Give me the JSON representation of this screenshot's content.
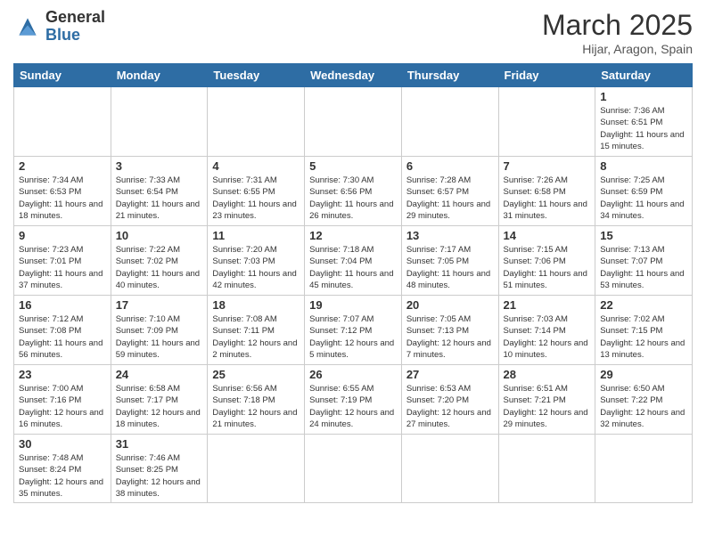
{
  "header": {
    "logo_general": "General",
    "logo_blue": "Blue",
    "month_title": "March 2025",
    "location": "Hijar, Aragon, Spain"
  },
  "weekdays": [
    "Sunday",
    "Monday",
    "Tuesday",
    "Wednesday",
    "Thursday",
    "Friday",
    "Saturday"
  ],
  "days": {
    "d1": {
      "num": "1",
      "sunrise": "7:36 AM",
      "sunset": "6:51 PM",
      "daylight": "11 hours and 15 minutes."
    },
    "d2": {
      "num": "2",
      "sunrise": "7:34 AM",
      "sunset": "6:53 PM",
      "daylight": "11 hours and 18 minutes."
    },
    "d3": {
      "num": "3",
      "sunrise": "7:33 AM",
      "sunset": "6:54 PM",
      "daylight": "11 hours and 21 minutes."
    },
    "d4": {
      "num": "4",
      "sunrise": "7:31 AM",
      "sunset": "6:55 PM",
      "daylight": "11 hours and 23 minutes."
    },
    "d5": {
      "num": "5",
      "sunrise": "7:30 AM",
      "sunset": "6:56 PM",
      "daylight": "11 hours and 26 minutes."
    },
    "d6": {
      "num": "6",
      "sunrise": "7:28 AM",
      "sunset": "6:57 PM",
      "daylight": "11 hours and 29 minutes."
    },
    "d7": {
      "num": "7",
      "sunrise": "7:26 AM",
      "sunset": "6:58 PM",
      "daylight": "11 hours and 31 minutes."
    },
    "d8": {
      "num": "8",
      "sunrise": "7:25 AM",
      "sunset": "6:59 PM",
      "daylight": "11 hours and 34 minutes."
    },
    "d9": {
      "num": "9",
      "sunrise": "7:23 AM",
      "sunset": "7:01 PM",
      "daylight": "11 hours and 37 minutes."
    },
    "d10": {
      "num": "10",
      "sunrise": "7:22 AM",
      "sunset": "7:02 PM",
      "daylight": "11 hours and 40 minutes."
    },
    "d11": {
      "num": "11",
      "sunrise": "7:20 AM",
      "sunset": "7:03 PM",
      "daylight": "11 hours and 42 minutes."
    },
    "d12": {
      "num": "12",
      "sunrise": "7:18 AM",
      "sunset": "7:04 PM",
      "daylight": "11 hours and 45 minutes."
    },
    "d13": {
      "num": "13",
      "sunrise": "7:17 AM",
      "sunset": "7:05 PM",
      "daylight": "11 hours and 48 minutes."
    },
    "d14": {
      "num": "14",
      "sunrise": "7:15 AM",
      "sunset": "7:06 PM",
      "daylight": "11 hours and 51 minutes."
    },
    "d15": {
      "num": "15",
      "sunrise": "7:13 AM",
      "sunset": "7:07 PM",
      "daylight": "11 hours and 53 minutes."
    },
    "d16": {
      "num": "16",
      "sunrise": "7:12 AM",
      "sunset": "7:08 PM",
      "daylight": "11 hours and 56 minutes."
    },
    "d17": {
      "num": "17",
      "sunrise": "7:10 AM",
      "sunset": "7:09 PM",
      "daylight": "11 hours and 59 minutes."
    },
    "d18": {
      "num": "18",
      "sunrise": "7:08 AM",
      "sunset": "7:11 PM",
      "daylight": "12 hours and 2 minutes."
    },
    "d19": {
      "num": "19",
      "sunrise": "7:07 AM",
      "sunset": "7:12 PM",
      "daylight": "12 hours and 5 minutes."
    },
    "d20": {
      "num": "20",
      "sunrise": "7:05 AM",
      "sunset": "7:13 PM",
      "daylight": "12 hours and 7 minutes."
    },
    "d21": {
      "num": "21",
      "sunrise": "7:03 AM",
      "sunset": "7:14 PM",
      "daylight": "12 hours and 10 minutes."
    },
    "d22": {
      "num": "22",
      "sunrise": "7:02 AM",
      "sunset": "7:15 PM",
      "daylight": "12 hours and 13 minutes."
    },
    "d23": {
      "num": "23",
      "sunrise": "7:00 AM",
      "sunset": "7:16 PM",
      "daylight": "12 hours and 16 minutes."
    },
    "d24": {
      "num": "24",
      "sunrise": "6:58 AM",
      "sunset": "7:17 PM",
      "daylight": "12 hours and 18 minutes."
    },
    "d25": {
      "num": "25",
      "sunrise": "6:56 AM",
      "sunset": "7:18 PM",
      "daylight": "12 hours and 21 minutes."
    },
    "d26": {
      "num": "26",
      "sunrise": "6:55 AM",
      "sunset": "7:19 PM",
      "daylight": "12 hours and 24 minutes."
    },
    "d27": {
      "num": "27",
      "sunrise": "6:53 AM",
      "sunset": "7:20 PM",
      "daylight": "12 hours and 27 minutes."
    },
    "d28": {
      "num": "28",
      "sunrise": "6:51 AM",
      "sunset": "7:21 PM",
      "daylight": "12 hours and 29 minutes."
    },
    "d29": {
      "num": "29",
      "sunrise": "6:50 AM",
      "sunset": "7:22 PM",
      "daylight": "12 hours and 32 minutes."
    },
    "d30": {
      "num": "30",
      "sunrise": "7:48 AM",
      "sunset": "8:24 PM",
      "daylight": "12 hours and 35 minutes."
    },
    "d31": {
      "num": "31",
      "sunrise": "7:46 AM",
      "sunset": "8:25 PM",
      "daylight": "12 hours and 38 minutes."
    }
  }
}
